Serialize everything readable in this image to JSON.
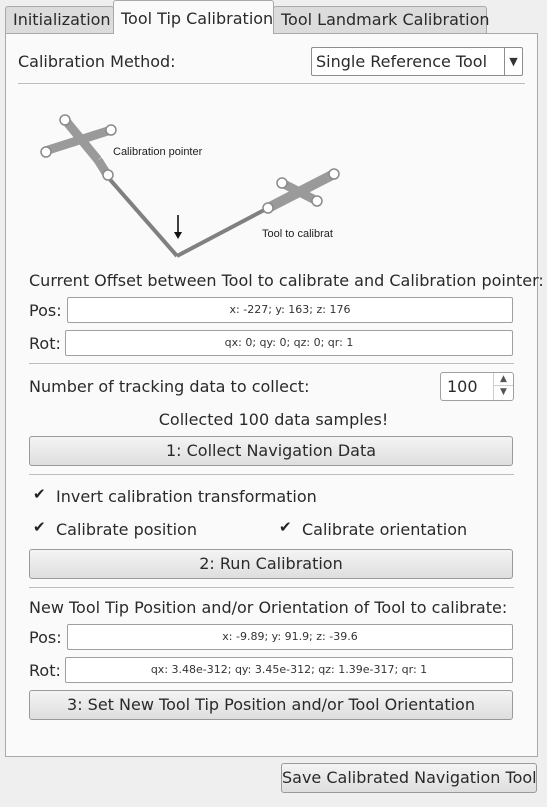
{
  "tabs": [
    "Initialization",
    "Tool Tip Calibration",
    "Tool Landmark Calibration"
  ],
  "active_tab": "Tool Tip Calibration",
  "calibration_method": {
    "label": "Calibration Method:",
    "selected": "Single Reference Tool"
  },
  "diagram": {
    "pointer_label": "Calibration pointer",
    "tool_label": "Tool to calibrat"
  },
  "current_offset": {
    "heading": "Current Offset between Tool to calibrate and Calibration pointer:",
    "pos_label": "Pos:",
    "pos_value": "x: -227; y: 163; z: 176",
    "rot_label": "Rot:",
    "rot_value": "qx: 0; qy: 0; qz: 0; qr: 1"
  },
  "tracking": {
    "label": "Number of tracking data to collect:",
    "value": "100",
    "status": "Collected 100 data samples!",
    "collect_button": "1: Collect Navigation Data"
  },
  "options": {
    "invert_label": "Invert calibration transformation",
    "invert_checked": true,
    "position_label": "Calibrate position",
    "position_checked": true,
    "orientation_label": "Calibrate orientation",
    "orientation_checked": true,
    "run_button": "2: Run Calibration"
  },
  "new_tip": {
    "heading": "New Tool Tip Position and/or Orientation of Tool to calibrate:",
    "pos_label": "Pos:",
    "pos_value": "x: -9.89; y: 91.9; z: -39.6",
    "rot_label": "Rot:",
    "rot_value": "qx: 3.48e-312; qy: 3.45e-312; qz: 1.39e-317; qr: 1",
    "set_button": "3: Set New Tool Tip Position and/or Tool Orientation"
  },
  "save_button": "Save Calibrated Navigation Tool"
}
